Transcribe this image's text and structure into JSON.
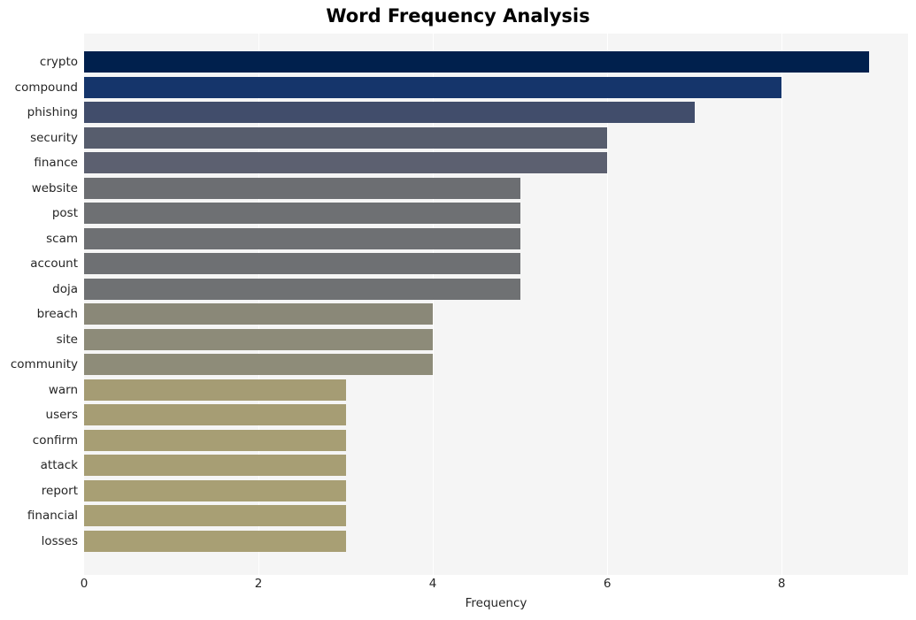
{
  "chart_data": {
    "type": "bar",
    "orientation": "horizontal",
    "title": "Word Frequency Analysis",
    "xlabel": "Frequency",
    "ylabel": "",
    "xlim": [
      0,
      9.45
    ],
    "xticks": [
      0,
      2,
      4,
      6,
      8
    ],
    "xtick_labels": [
      "0",
      "2",
      "4",
      "6",
      "8"
    ],
    "grid": true,
    "grid_axis": "x",
    "legend": null,
    "plot_background": "#f5f5f5",
    "figure_background": "#ffffff",
    "gridline_color": "#ffffff",
    "categories": [
      "crypto",
      "compound",
      "phishing",
      "security",
      "finance",
      "website",
      "post",
      "scam",
      "account",
      "doja",
      "breach",
      "site",
      "community",
      "warn",
      "users",
      "confirm",
      "attack",
      "report",
      "financial",
      "losses"
    ],
    "values": [
      9,
      8,
      7,
      6,
      6,
      5,
      5,
      5,
      5,
      5,
      4,
      4,
      4,
      3,
      3,
      3,
      3,
      3,
      3,
      3
    ],
    "bar_colors": [
      "#00204d",
      "#15356b",
      "#414d6b",
      "#575d6d",
      "#5c6070",
      "#6c6e72",
      "#6e7073",
      "#6e7073",
      "#6e7073",
      "#6f7173",
      "#8a8878",
      "#8d8b79",
      "#8e8c79",
      "#a59c74",
      "#a69d74",
      "#a79e74",
      "#a79e74",
      "#a89f74",
      "#a89f74",
      "#a89f74"
    ]
  }
}
